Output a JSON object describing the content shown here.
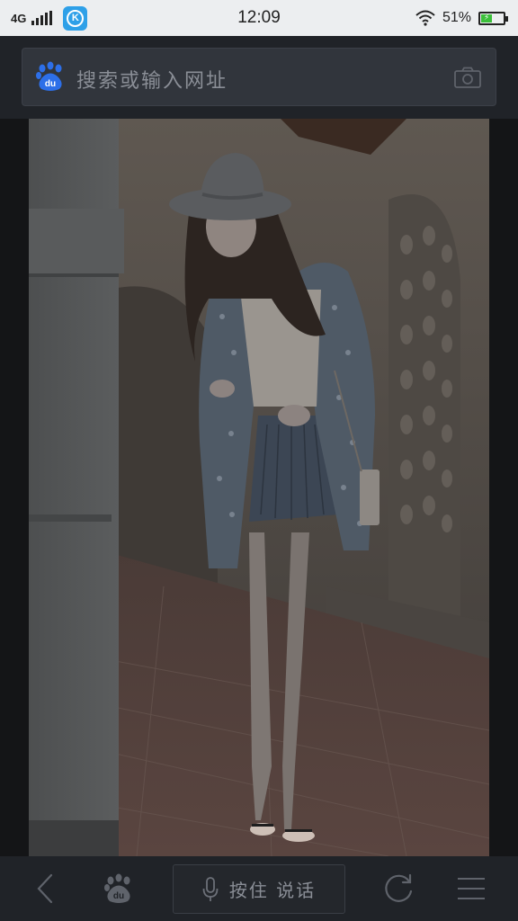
{
  "status_bar": {
    "network": "4G",
    "time": "12:09",
    "battery_percent": "51%",
    "battery_level": 0.51,
    "app_icon": "k-app-icon"
  },
  "search": {
    "placeholder": "搜索或输入网址",
    "logo": "baidu-paw-icon",
    "camera": "camera-icon"
  },
  "bottom_bar": {
    "voice_label": "按住 说话",
    "items": [
      "back-icon",
      "baidu-home-icon",
      "microphone-icon",
      "refresh-icon",
      "menu-icon"
    ]
  },
  "colors": {
    "baidu_blue": "#2d6fe8",
    "battery_green": "#3bbf3a",
    "toolbar_bg": "#202328",
    "status_bg": "#eceef0"
  }
}
